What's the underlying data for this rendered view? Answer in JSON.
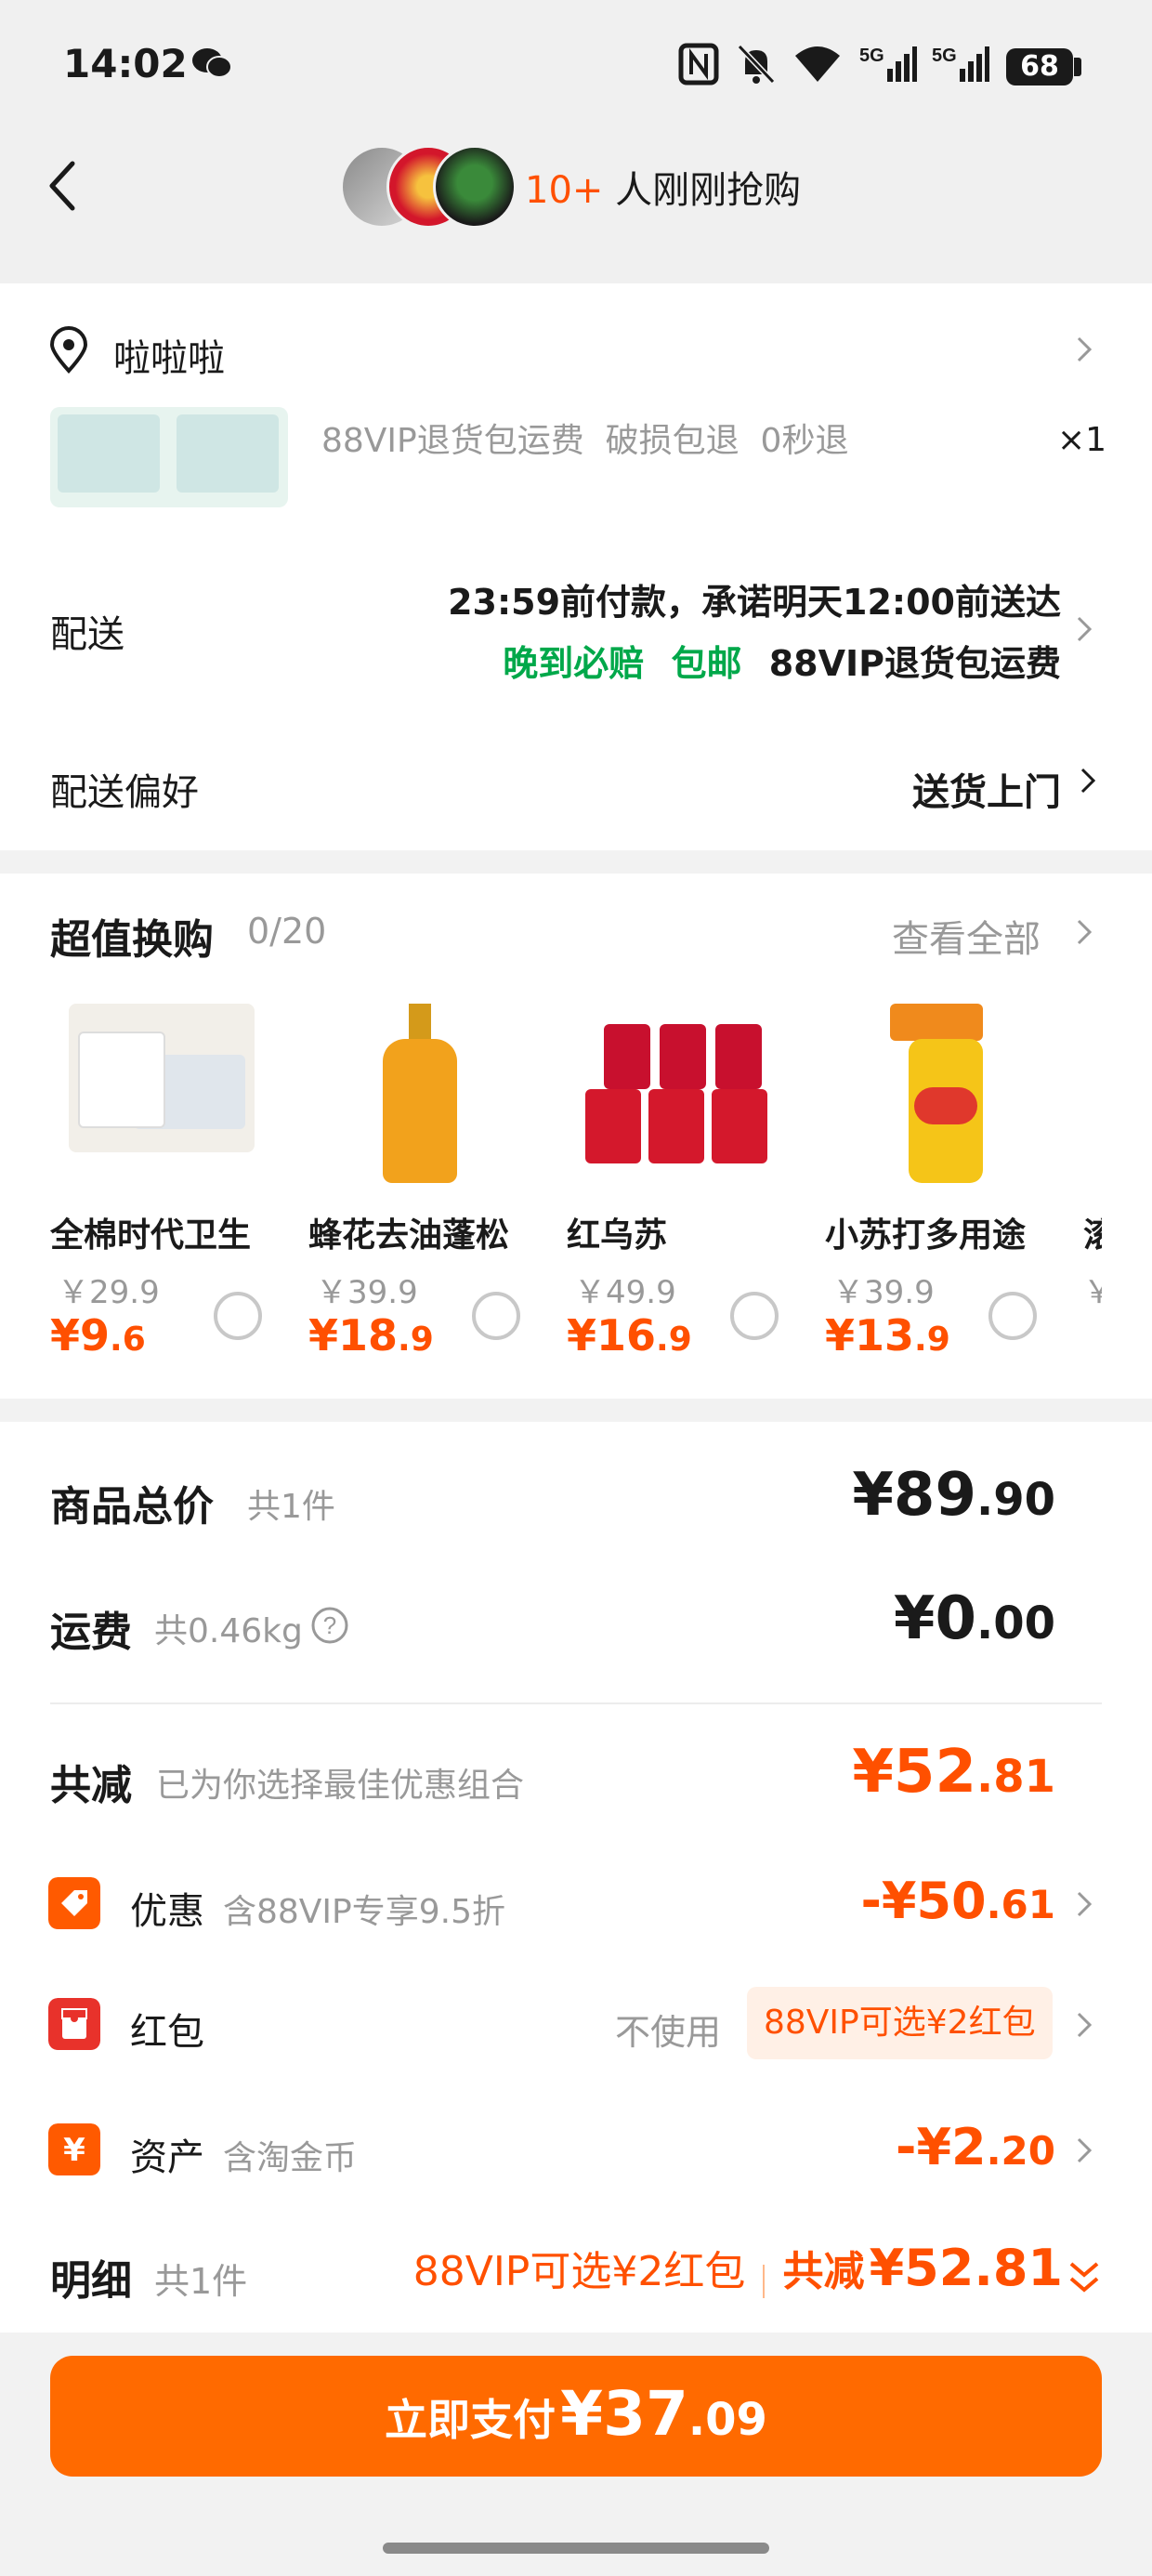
{
  "status_bar": {
    "time": "14:02",
    "battery": "68"
  },
  "header": {
    "count": "10+",
    "text": "人刚刚抢购"
  },
  "address": {
    "name": "啦啦啦"
  },
  "item": {
    "tags": "88VIP退货包运费  破损包退  0秒退",
    "qty": "×1"
  },
  "delivery": {
    "label": "配送",
    "line1": "23:59前付款，承诺明天12:00前送达",
    "tag_late": "晚到必赔",
    "tag_free": "包邮",
    "tag_vip": "88VIP退货包运费"
  },
  "delivery_pref": {
    "label": "配送偏好",
    "value": "送货上门"
  },
  "swap": {
    "title": "超值换购",
    "count": "0/20",
    "view_all": "查看全部",
    "products": [
      {
        "name": "全棉时代卫生",
        "orig": "￥29.9",
        "sale_int": "¥9",
        "sale_dec": ".6"
      },
      {
        "name": "蜂花去油蓬松",
        "orig": "￥39.9",
        "sale_int": "¥18",
        "sale_dec": ".9"
      },
      {
        "name": "红乌苏",
        "orig": "￥49.9",
        "sale_int": "¥16",
        "sale_dec": ".9"
      },
      {
        "name": "小苏打多用途",
        "orig": "￥39.9",
        "sale_int": "¥13",
        "sale_dec": ".9"
      }
    ],
    "partial_name": "滚",
    "partial_orig": "￥",
    "partial_sale": "¥"
  },
  "summary": {
    "goods_label": "商品总价",
    "goods_count": "共1件",
    "goods_int": "¥89",
    "goods_dec": ".90",
    "ship_label": "运费",
    "ship_weight": "共0.46kg",
    "ship_int": "¥0",
    "ship_dec": ".00",
    "reduce_label": "共减",
    "reduce_note": "已为你选择最佳优惠组合",
    "reduce_int": "¥52",
    "reduce_dec": ".81",
    "promo_label": "优惠",
    "promo_note": "含88VIP专享9.5折",
    "promo_int": "-¥50",
    "promo_dec": ".61",
    "redpack_label": "红包",
    "redpack_status": "不使用",
    "redpack_tag": "88VIP可选¥2红包",
    "asset_label": "资产",
    "asset_note": "含淘金币",
    "asset_int": "-¥2",
    "asset_dec": ".20"
  },
  "detail": {
    "label": "明细",
    "count": "共1件",
    "redpack": "88VIP可选¥2红包",
    "reduce_label": "共减",
    "reduce_value": "¥52.81"
  },
  "pay": {
    "label": "立即支付",
    "int": "¥37",
    "dec": ".09"
  }
}
